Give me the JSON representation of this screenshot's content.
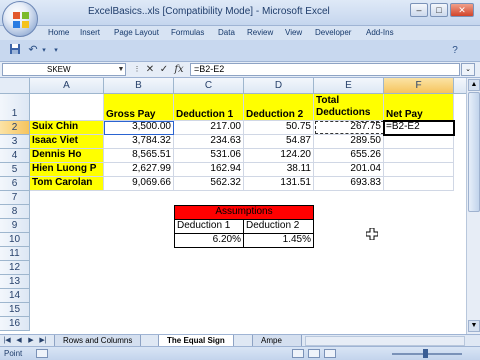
{
  "window": {
    "title": "ExcelBasics..xls  [Compatibility Mode] - Microsoft Excel",
    "minimize": "–",
    "maximize": "□",
    "close": "✕"
  },
  "menu": [
    "Home",
    "Insert",
    "Page Layout",
    "Formulas",
    "Data",
    "Review",
    "View",
    "Developer",
    "Add-Ins"
  ],
  "formula_bar": {
    "name_box": "SKEW",
    "formula": "=B2-E2",
    "fx": "fx",
    "cancel": "✕",
    "enter": "✓"
  },
  "columns": [
    "A",
    "B",
    "C",
    "D",
    "E",
    "F"
  ],
  "rows": [
    "1",
    "2",
    "3",
    "4",
    "5",
    "6",
    "7",
    "8",
    "9",
    "10",
    "11",
    "12",
    "13",
    "14",
    "15",
    "16"
  ],
  "table": {
    "headers": [
      "Gross Pay",
      "Deduction 1",
      "Deduction 2",
      "Total Deductions",
      "Net Pay"
    ],
    "employees": [
      {
        "name": "Suix Chin",
        "gross": "3,500.00",
        "d1": "217.00",
        "d2": "50.75",
        "total": "267.75",
        "net": "=B2-E2"
      },
      {
        "name": "Isaac Viet",
        "gross": "3,784.32",
        "d1": "234.63",
        "d2": "54.87",
        "total": "289.50",
        "net": ""
      },
      {
        "name": "Dennis Ho",
        "gross": "8,565.51",
        "d1": "531.06",
        "d2": "124.20",
        "total": "655.26",
        "net": ""
      },
      {
        "name": "Hien Luong P",
        "gross": "2,627.99",
        "d1": "162.94",
        "d2": "38.11",
        "total": "201.04",
        "net": ""
      },
      {
        "name": "Tom Carolan",
        "gross": "9,069.66",
        "d1": "562.32",
        "d2": "131.51",
        "total": "693.83",
        "net": ""
      }
    ]
  },
  "assumptions": {
    "title": "Assumptions",
    "labels": [
      "Deduction 1",
      "Deduction 2"
    ],
    "values": [
      "6.20%",
      "1.45%"
    ]
  },
  "sheet_tabs": [
    "Rows and Columns",
    "The Equal Sign",
    "Ampe"
  ],
  "active_tab": "The Equal Sign",
  "status": {
    "mode": "Point"
  },
  "colors": {
    "highlight": "#ffff00",
    "assumptions_header": "#ff0000",
    "selected_header": "#f6c45d"
  }
}
